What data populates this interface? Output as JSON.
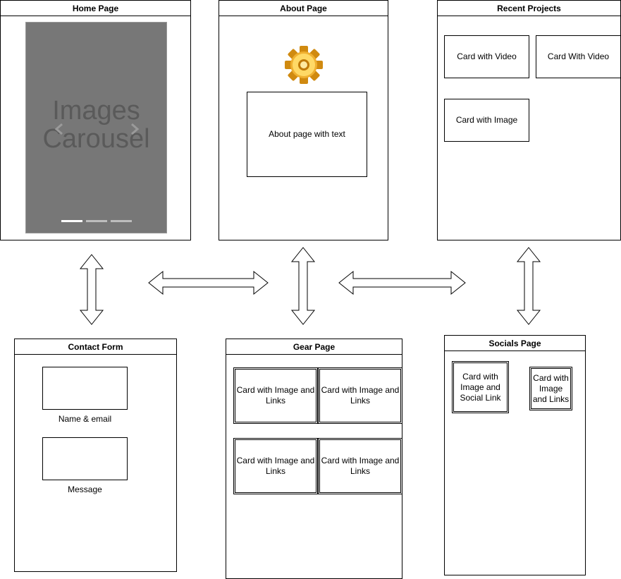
{
  "home": {
    "title": "Home Page",
    "carousel_text": "Images Carousel"
  },
  "about": {
    "title": "About Page",
    "text": "About page with text"
  },
  "recent": {
    "title": "Recent Projects",
    "cards": [
      "Card with Video",
      "Card With Video",
      "Card with Image"
    ]
  },
  "contact": {
    "title": "Contact Form",
    "fields": [
      "Name & email",
      "Message"
    ]
  },
  "gear": {
    "title": "Gear Page",
    "cards": [
      "Card with Image and Links",
      "Card with Image and Links",
      "Card with Image and Links",
      "Card with Image and Links"
    ]
  },
  "socials": {
    "title": "Socials Page",
    "cards": [
      "Card with Image and Social Link",
      "Card with Image and Links"
    ]
  },
  "colors": {
    "carousel_bg": "#777777",
    "gear_light": "#ffd966",
    "gear_dark": "#d08a10"
  },
  "icons": {
    "about": "gear-icon",
    "carousel_prev": "chevron-left-icon",
    "carousel_next": "chevron-right-icon"
  }
}
